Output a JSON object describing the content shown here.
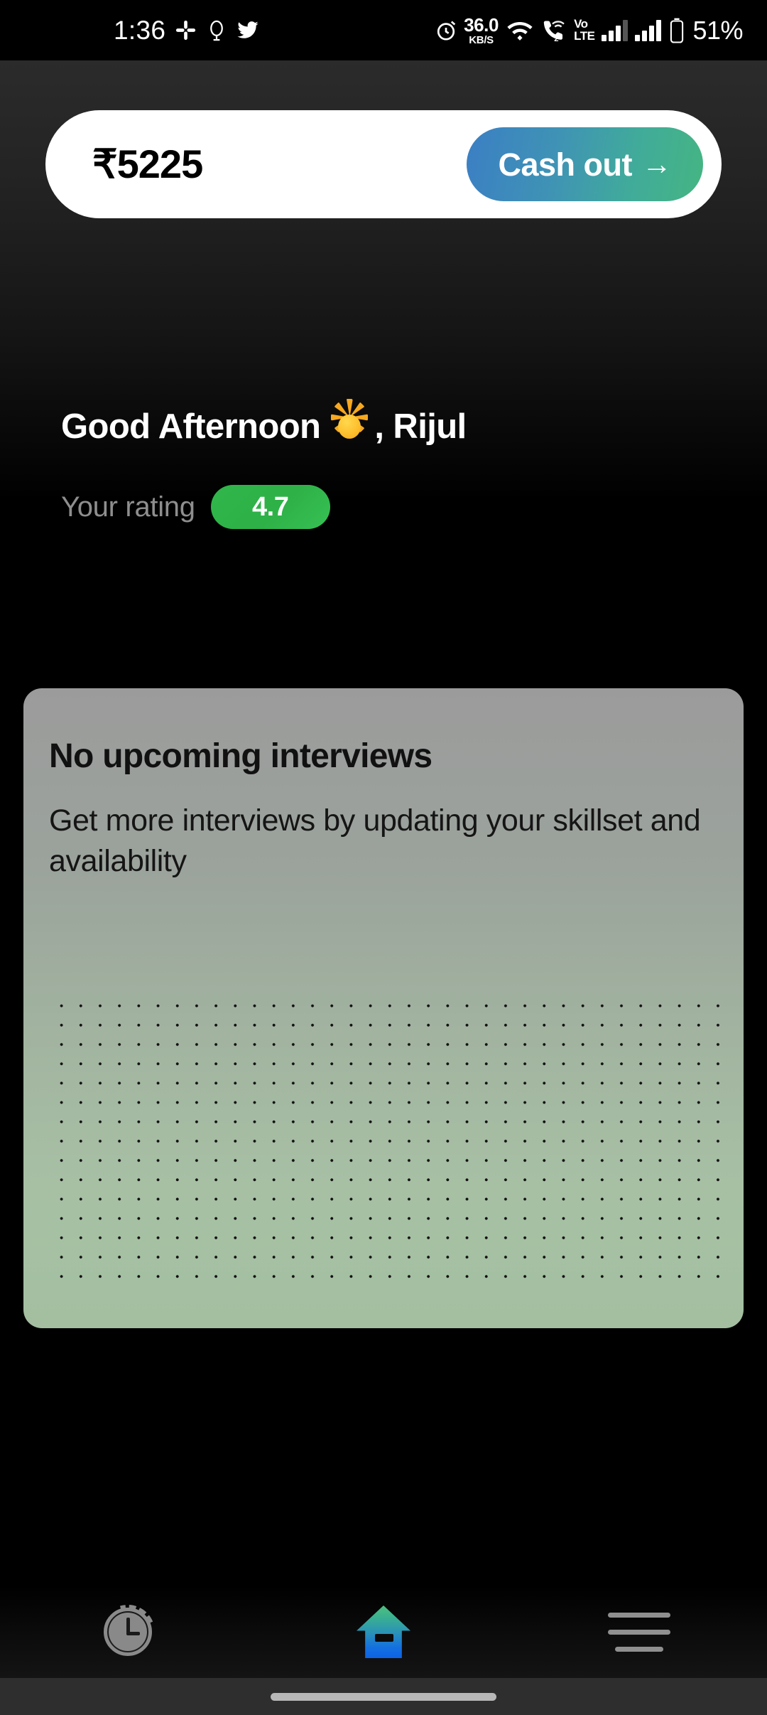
{
  "status_bar": {
    "time": "1:36",
    "left_icons": [
      "slack-icon",
      "dribbble-icon",
      "twitter-icon"
    ],
    "alarm_icon": "alarm-clock-icon",
    "net_speed_value": "36.0",
    "net_speed_unit": "KB/S",
    "wifi_icon": "wifi-icon",
    "call_icon": "call-wifi-icon",
    "sim_badge": "2",
    "volte_line1": "Vo",
    "volte_line2": "LTE",
    "signal_icon_1": "signal-bars-icon",
    "signal_icon_2": "signal-bars-icon",
    "battery_icon": "battery-icon",
    "battery_percent": "51%"
  },
  "wallet": {
    "balance": "₹5225",
    "cash_out_label": "Cash out",
    "cash_out_arrow": "→",
    "gradient_from": "#3b7fc4",
    "gradient_to": "#45b582"
  },
  "greeting": {
    "prefix": "Good Afternoon",
    "emoji_name": "sun-emoji",
    "suffix": ", Rijul",
    "user_name": "Rijul"
  },
  "rating": {
    "label": "Your rating",
    "value": "4.7",
    "pill_color": "#2fb64a"
  },
  "interview_card": {
    "title": "No upcoming interviews",
    "subtitle": "Get more interviews by updating your skillset and availability",
    "gradient_from": "#9b9b9b",
    "gradient_to": "#a3bfa0",
    "pattern": "dot-grid"
  },
  "bottom_nav": {
    "items": [
      {
        "name": "history",
        "icon": "clock-history-icon",
        "active": false
      },
      {
        "name": "home",
        "icon": "home-icon",
        "active": true
      },
      {
        "name": "menu",
        "icon": "hamburger-menu-icon",
        "active": false
      }
    ]
  },
  "system": {
    "gesture_bar": "home-gesture-bar"
  }
}
